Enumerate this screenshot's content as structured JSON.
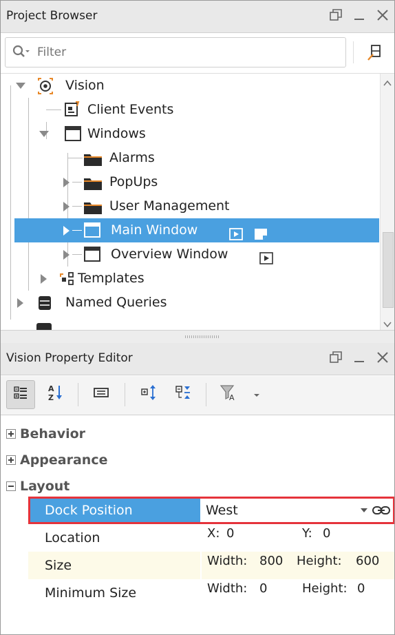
{
  "project_browser": {
    "title": "Project Browser",
    "filter_placeholder": "Filter",
    "tree": {
      "vision": "Vision",
      "client_events": "Client Events",
      "windows": "Windows",
      "alarms": "Alarms",
      "popups": "PopUps",
      "user_management": "User Management",
      "main_window": "Main Window",
      "overview_window": "Overview Window",
      "templates": "Templates",
      "named_queries": "Named Queries"
    }
  },
  "property_editor": {
    "title": "Vision Property Editor",
    "categories": {
      "behavior": "Behavior",
      "appearance": "Appearance",
      "layout": "Layout"
    },
    "properties": {
      "dock_position": {
        "name": "Dock Position",
        "value": "West"
      },
      "location": {
        "name": "Location",
        "x_label": "X:",
        "x": "0",
        "y_label": "Y:",
        "y": "0"
      },
      "size": {
        "name": "Size",
        "width_label": "Width:",
        "width": "800",
        "height_label": "Height:",
        "height": "600"
      },
      "minimum_size": {
        "name": "Minimum Size",
        "width_label": "Width:",
        "width": "0",
        "height_label": "Height:",
        "height": "0"
      }
    }
  },
  "colors": {
    "selection": "#4aa0e0",
    "highlight_border": "#e5333b",
    "folder": "#2b2b2b",
    "vision_orange": "#e8892a"
  },
  "icons": [
    "restore-icon",
    "minimize-icon",
    "close-icon",
    "search-icon",
    "pin-icon",
    "vision-icon",
    "client-events-icon",
    "window-icon",
    "folder-icon",
    "play-icon",
    "bookmark-icon",
    "templates-icon",
    "database-icon",
    "categorized-icon",
    "sort-az-icon",
    "card-icon",
    "expand-icon",
    "collapse-icon",
    "filter-icon",
    "link-icon"
  ]
}
